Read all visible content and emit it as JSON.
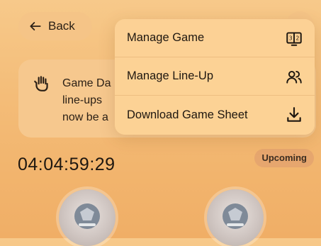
{
  "header": {
    "back_label": "Back"
  },
  "banner": {
    "lines": [
      "Game Da",
      "line-ups",
      "now be a"
    ]
  },
  "timer": {
    "countdown": "04:04:59:29"
  },
  "status": {
    "badge": "Upcoming"
  },
  "menu": {
    "items": [
      {
        "label": "Manage Game",
        "icon": "scoreboard-icon"
      },
      {
        "label": "Manage Line-Up",
        "icon": "users-icon"
      },
      {
        "label": "Download Game Sheet",
        "icon": "download-icon"
      }
    ]
  },
  "teams": {
    "home_logo": "team-logo-icon",
    "away_logo": "team-logo-icon"
  },
  "colors": {
    "background": "#f4bd79",
    "menu": "#fcd296",
    "badge": "#e1a06e"
  }
}
